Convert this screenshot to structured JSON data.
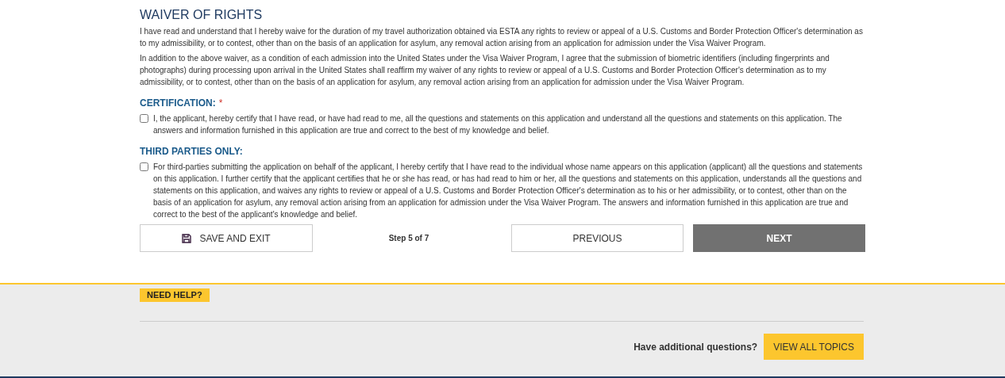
{
  "waiver": {
    "title": "WAIVER OF RIGHTS",
    "paragraphs": [
      "I have read and understand that I hereby waive for the duration of my travel authorization obtained via ESTA any rights to review or appeal of a U.S. Customs and Border Protection Officer's determination as to my admissibility, or to contest, other than on the basis of an application for asylum, any removal action arising from an application for admission under the Visa Waiver Program.",
      "In addition to the above waiver, as a condition of each admission into the United States under the Visa Waiver Program, I agree that the submission of biometric identifiers (including fingerprints and photographs) during processing upon arrival in the United States shall reaffirm my waiver of any rights to review or appeal of a U.S. Customs and Border Protection Officer's determination as to my admissibility, or to contest, other than on the basis of an application for asylum, any removal action arising from an application for admission under the Visa Waiver Program."
    ]
  },
  "sections": [
    {
      "heading": "CERTIFICATION:",
      "required_mark": "*",
      "checked": false,
      "text": "I, the applicant, hereby certify that I have read, or have had read to me, all the questions and statements on this application and understand all the questions and statements on this application. The answers and information furnished in this application are true and correct to the best of my knowledge and belief."
    },
    {
      "heading": "THIRD PARTIES ONLY:",
      "checked": false,
      "text": "For third-parties submitting the application on behalf of the applicant, I hereby certify that I have read to the individual whose name appears on this application (applicant) all the questions and statements on this application. I further certify that the applicant certifies that he or she has read, or has had read to him or her, all the questions and statements on this application, understands all the questions and statements on this application, and waives any rights to review or appeal of a U.S. Customs and Border Protection Officer's determination as to his or her admissibility, or to contest, other than on the basis of an application for asylum, any removal action arising from an application for admission under the Visa Waiver Program. The answers and information furnished in this application are true and correct to the best of the applicant's knowledge and belief."
    }
  ],
  "navigation": {
    "save_button": "SAVE AND EXIT",
    "step": "Step 5 of 7",
    "previous_button": "PREVIOUS",
    "next_button": "NEXT"
  },
  "help": {
    "tag": "NEED HELP?",
    "question": "Have additional questions?",
    "topics_button": "VIEW ALL TOPICS"
  }
}
